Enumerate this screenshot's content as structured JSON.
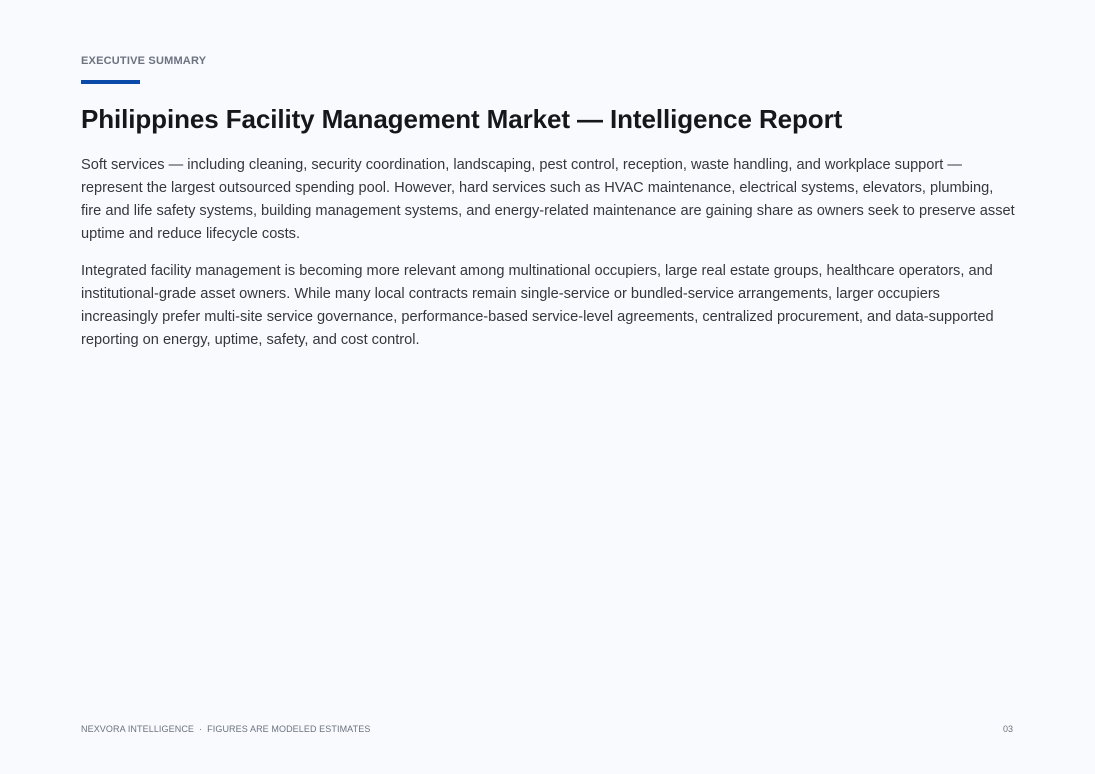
{
  "header": {
    "section_label": "EXECUTIVE SUMMARY",
    "title": "Philippines Facility Management Market — Intelligence Report"
  },
  "body": {
    "paragraphs": [
      "Soft services — including cleaning, security coordination, landscaping, pest control, reception, waste handling, and workplace support — represent the largest outsourced spending pool. However, hard services such as HVAC maintenance, electrical systems, elevators, plumbing, fire and life safety systems, building management systems, and energy-related maintenance are gaining share as owners seek to preserve asset uptime and reduce lifecycle costs.",
      "Integrated facility management is becoming more relevant among multinational occupiers, large real estate groups, healthcare operators, and institutional-grade asset owners. While many local contracts remain single-service or bundled-service arrangements, larger occupiers increasingly prefer multi-site service governance, performance-based service-level agreements, centralized procurement, and data-supported reporting on energy, uptime, safety, and cost control."
    ]
  },
  "footer": {
    "brand": "NEXVORA INTELLIGENCE",
    "separator": "·",
    "note": "FIGURES ARE MODELED ESTIMATES",
    "page_number": "03"
  },
  "colors": {
    "accent": "#0b4aa8",
    "background": "#f9fafd",
    "title": "#15171a",
    "muted": "#6b7280"
  }
}
